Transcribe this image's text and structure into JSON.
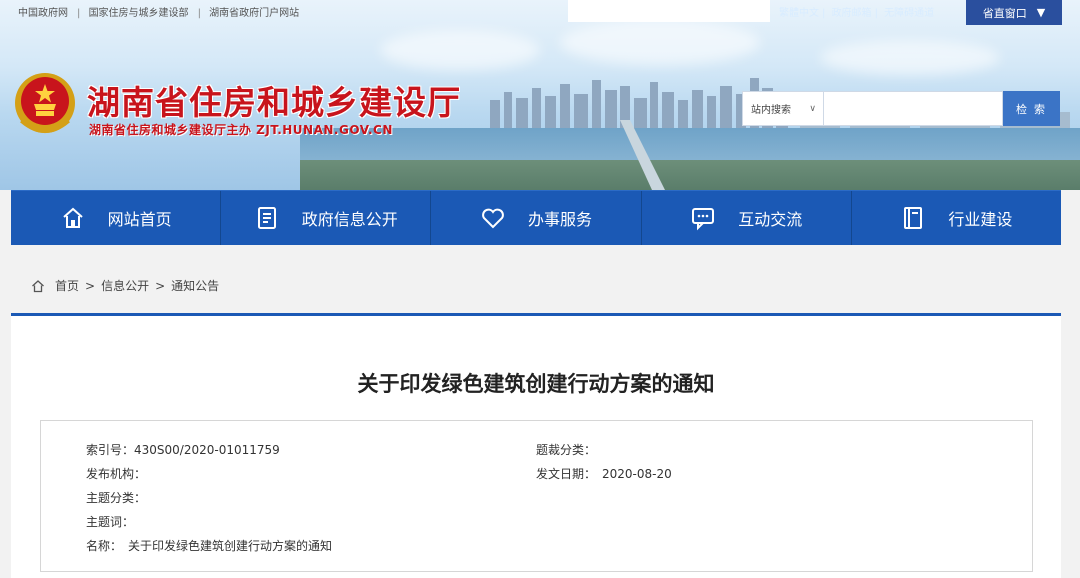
{
  "topbar": {
    "links": [
      "中国政府网",
      "国家住房与城乡建设部",
      "湖南省政府门户网站"
    ],
    "right_links": [
      "繁體中文",
      "政府邮箱",
      "无障碍通道"
    ],
    "province_button": "省直窗口"
  },
  "header": {
    "title": "湖南省住房和城乡建设厅",
    "subtitle": "湖南省住房和城乡建设厅主办 ZJT.HUNAN.GOV.CN"
  },
  "search": {
    "scope": "站内搜索",
    "placeholder": "",
    "button": "检 索"
  },
  "nav": {
    "items": [
      {
        "label": "网站首页",
        "icon": "home-icon"
      },
      {
        "label": "政府信息公开",
        "icon": "document-icon"
      },
      {
        "label": "办事服务",
        "icon": "heart-icon"
      },
      {
        "label": "互动交流",
        "icon": "chat-icon"
      },
      {
        "label": "行业建设",
        "icon": "book-icon"
      }
    ]
  },
  "breadcrumb": {
    "items": [
      "首页",
      "信息公开",
      "通知公告"
    ],
    "sep": ">"
  },
  "document": {
    "title": "关于印发绿色建筑创建行动方案的通知",
    "meta": {
      "index_label": "索引号：",
      "index_value": "430S00/2020-01011759",
      "genre_label": "题裁分类：",
      "genre_value": "",
      "publisher_label": "发布机构：",
      "publisher_value": "",
      "date_label": "发文日期：",
      "date_value": "2020-08-20",
      "topic_label": "主题分类：",
      "topic_value": "",
      "keywords_label": "主题词：",
      "keywords_value": "",
      "name_label": "名称：",
      "name_value": "关于印发绿色建筑创建行动方案的通知"
    }
  },
  "colors": {
    "nav_blue": "#1b59b5",
    "title_red": "#c8141c",
    "search_blue": "#3b74c6"
  }
}
